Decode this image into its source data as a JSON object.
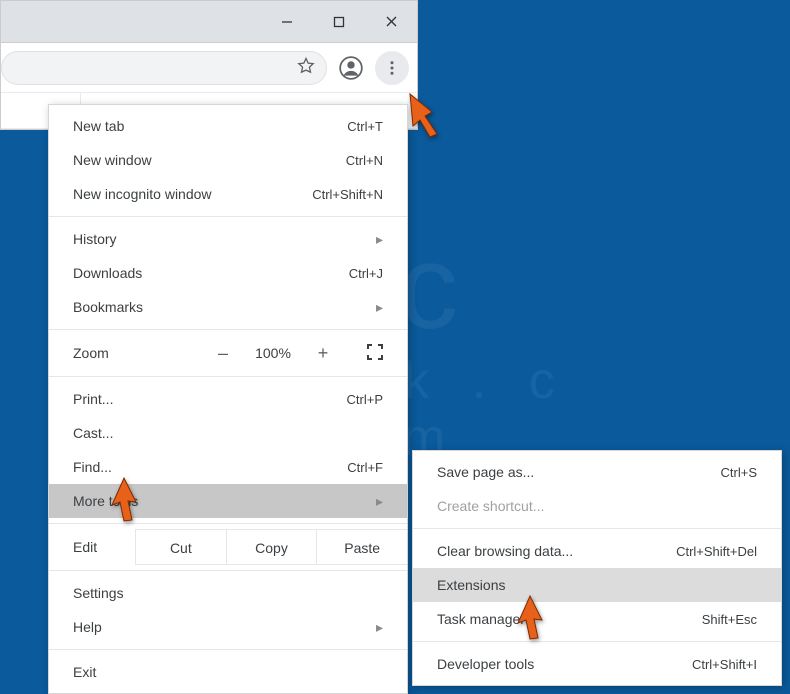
{
  "window": {
    "minimize": "minimize-icon",
    "maximize": "maximize-icon",
    "close": "close-icon"
  },
  "toolbar": {
    "star": "star-icon",
    "profile": "person-icon",
    "kebab": "kebab-icon"
  },
  "menu": {
    "newTab": {
      "label": "New tab",
      "shortcut": "Ctrl+T"
    },
    "newWindow": {
      "label": "New window",
      "shortcut": "Ctrl+N"
    },
    "incognito": {
      "label": "New incognito window",
      "shortcut": "Ctrl+Shift+N"
    },
    "history": {
      "label": "History"
    },
    "downloads": {
      "label": "Downloads",
      "shortcut": "Ctrl+J"
    },
    "bookmarks": {
      "label": "Bookmarks"
    },
    "zoom": {
      "label": "Zoom",
      "minus": "–",
      "pct": "100%",
      "plus": "+"
    },
    "print": {
      "label": "Print...",
      "shortcut": "Ctrl+P"
    },
    "cast": {
      "label": "Cast..."
    },
    "find": {
      "label": "Find...",
      "shortcut": "Ctrl+F"
    },
    "moreTools": {
      "label": "More tools"
    },
    "edit": {
      "label": "Edit",
      "cut": "Cut",
      "copy": "Copy",
      "paste": "Paste"
    },
    "settings": {
      "label": "Settings"
    },
    "help": {
      "label": "Help"
    },
    "exit": {
      "label": "Exit"
    }
  },
  "submenu": {
    "savePage": {
      "label": "Save page as...",
      "shortcut": "Ctrl+S"
    },
    "createShortcut": {
      "label": "Create shortcut..."
    },
    "clearData": {
      "label": "Clear browsing data...",
      "shortcut": "Ctrl+Shift+Del"
    },
    "extensions": {
      "label": "Extensions"
    },
    "taskManager": {
      "label": "Task manager",
      "shortcut": "Shift+Esc"
    },
    "devTools": {
      "label": "Developer tools",
      "shortcut": "Ctrl+Shift+I"
    }
  }
}
